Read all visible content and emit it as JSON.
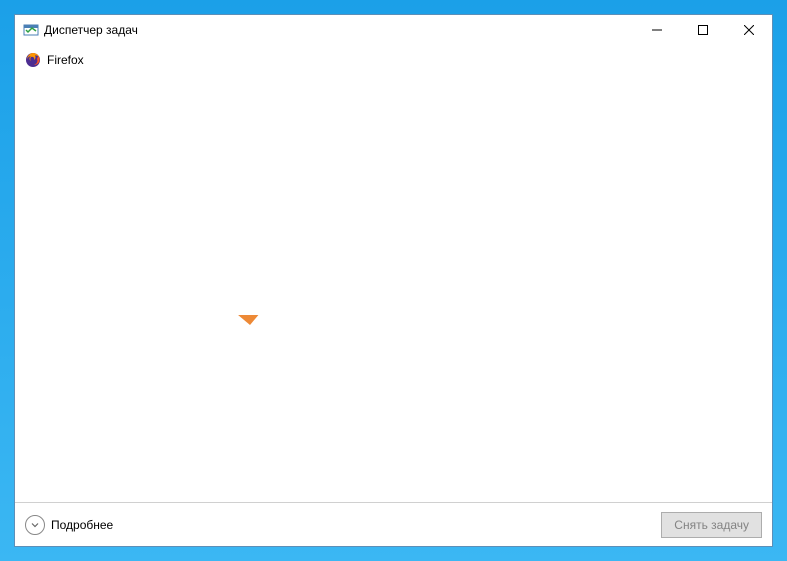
{
  "window": {
    "title": "Диспетчер задач"
  },
  "tasks": [
    {
      "name": "Firefox",
      "icon": "firefox"
    }
  ],
  "footer": {
    "more_details": "Подробнее",
    "end_task": "Снять задачу"
  }
}
